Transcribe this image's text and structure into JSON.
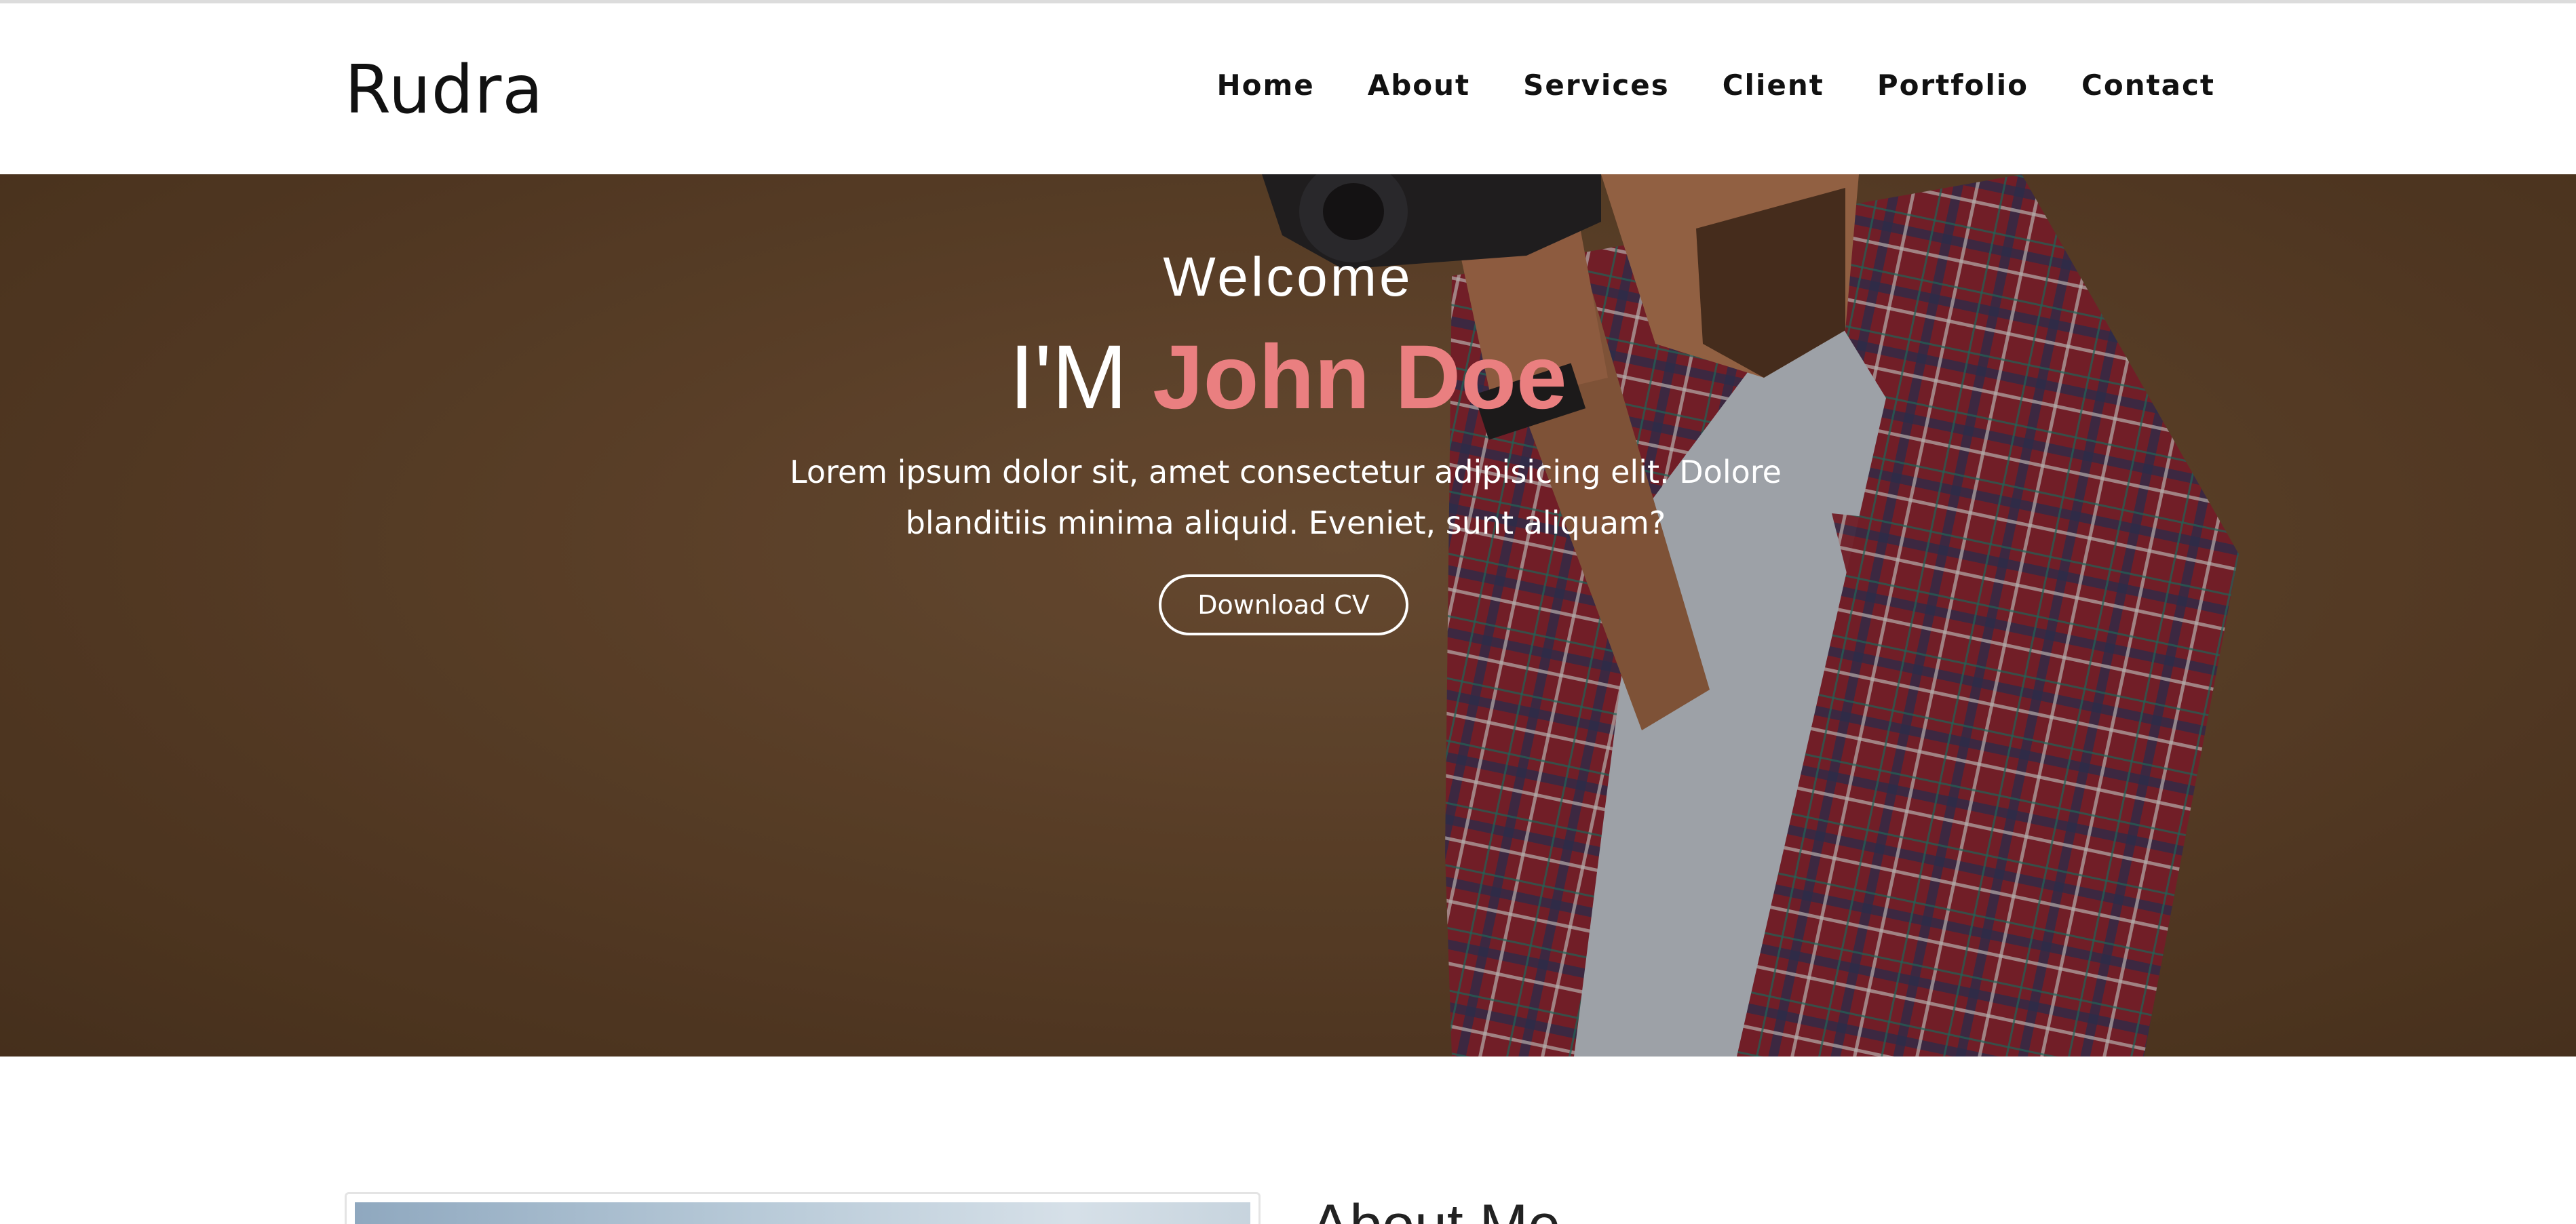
{
  "brand": {
    "name": "Rudra"
  },
  "nav": {
    "items": [
      "Home",
      "About",
      "Services",
      "Client",
      "Portfolio",
      "Contact"
    ]
  },
  "hero": {
    "welcome": "Welcome",
    "headline_prefix": "I'M",
    "headline_name": "John Doe",
    "description": "Lorem ipsum dolor sit, amet consectetur adipisicing elit. Dolore blanditiis minima aliquid. Eveniet, sunt aliquam?",
    "cta_label": "Download CV",
    "name_color": "#ea7f80",
    "background_color": "#5a3f28"
  },
  "about": {
    "title": "About Me"
  }
}
